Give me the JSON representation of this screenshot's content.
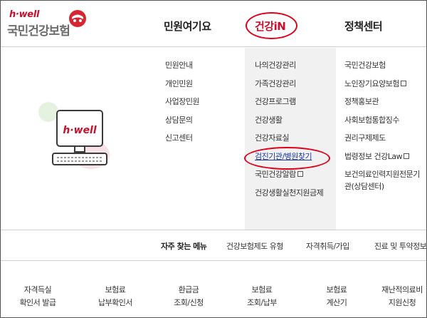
{
  "logo": {
    "brand": "h·well",
    "name": "국민건강보험"
  },
  "nav": {
    "civil": "민원여기요",
    "health": "건강iN",
    "policy": "정책센터"
  },
  "illustration": {
    "screen_text": "h·well"
  },
  "menu": {
    "civil": [
      "민원안내",
      "개인민원",
      "사업장민원",
      "상담문의",
      "신고센터"
    ],
    "health": [
      {
        "label": "나의건강관리"
      },
      {
        "label": "가족건강관리"
      },
      {
        "label": "건강프로그램"
      },
      {
        "label": "건강생활"
      },
      {
        "label": "건강자료실"
      },
      {
        "label": "검진기관/병원찾기"
      },
      {
        "label": "국민건강알람",
        "external": true
      },
      {
        "label": "건강생활실천지원금제"
      }
    ],
    "policy": [
      {
        "label": "국민건강보험"
      },
      {
        "label": "노인장기요양보험",
        "external": true
      },
      {
        "label": "정책홍보관"
      },
      {
        "label": "사회보험통합징수"
      },
      {
        "label": "권리구제제도"
      },
      {
        "label": "법령정보 건강Law",
        "external": true
      },
      {
        "label": "보건의료인력지원전문기관(상담센터)"
      }
    ]
  },
  "frequent": {
    "label": "자주 찾는 메뉴",
    "items": [
      "건강보험제도 유형",
      "자격취득/가입",
      "진료 및 투약정보"
    ]
  },
  "quick_menu": [
    [
      "자격득실",
      "확인서 발급"
    ],
    [
      "보험료",
      "납부확인서"
    ],
    [
      "환급금",
      "조회/신청"
    ],
    [
      "보험료",
      "조회/납부"
    ],
    [
      "보험료",
      "계산기"
    ],
    [
      "재난적의료비",
      "지원신청"
    ]
  ],
  "colors": {
    "brand_red": "#c8102e",
    "annotation_red": "#e0001a",
    "link_blue": "#1b3aa8",
    "column_highlight": "#f1f1f1"
  }
}
